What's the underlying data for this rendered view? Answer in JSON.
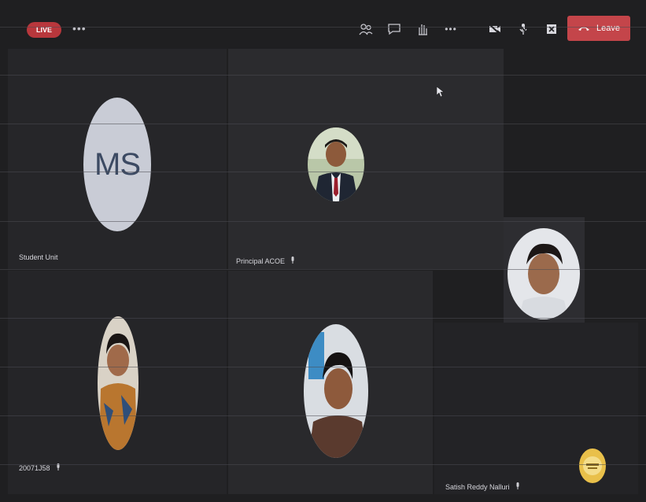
{
  "header": {
    "live_badge": "LIVE",
    "more_label": "•••",
    "toolbar_more_label": "•••",
    "leave_label": "Leave"
  },
  "participants": [
    {
      "id": "p1",
      "initials": "MS",
      "name": "Student Unit"
    },
    {
      "id": "p2",
      "name": "Principal ACOE"
    },
    {
      "id": "p3",
      "name": ""
    },
    {
      "id": "p4",
      "name": "20071J58"
    },
    {
      "id": "p5",
      "name": ""
    },
    {
      "id": "p6",
      "name": "Satish Reddy Nalluri"
    }
  ],
  "colors": {
    "leave": "#c4454a",
    "live": "#b8373c",
    "background": "#1f1f21"
  }
}
